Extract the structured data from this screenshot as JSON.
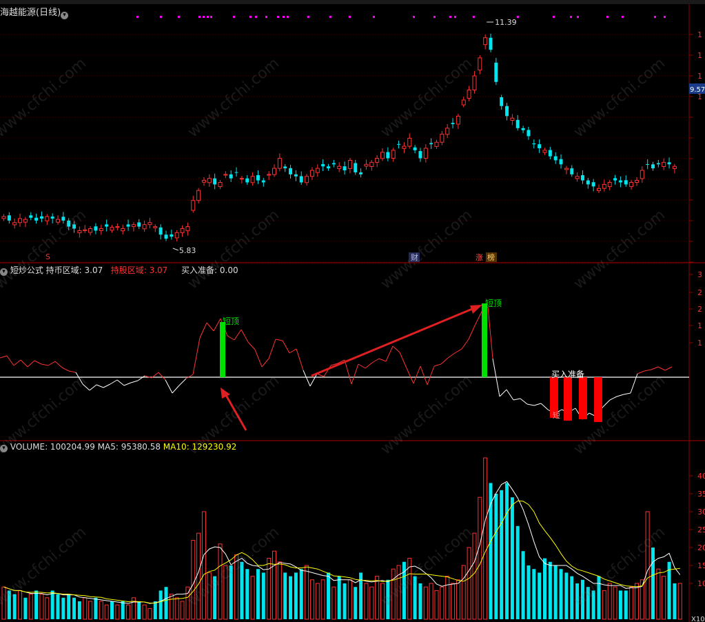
{
  "header": {
    "stock_title": "海越能源(日线)"
  },
  "price_panel": {
    "high_label": "11.39",
    "low_label": "5.83",
    "current_price_tag": "9.57",
    "marker_s": "S",
    "event_fin": "财",
    "event_zhang": "涨",
    "event_bang": "榜",
    "y_ticks": [
      "1",
      "1",
      "1",
      "1"
    ]
  },
  "indicator_panel": {
    "name": "短炒公式",
    "hold_label": "持币区域:",
    "hold_value": "3.07",
    "stock_label": "持股区域:",
    "stock_value": "3.07",
    "buy_label": "买入准备:",
    "buy_value": "0.00",
    "annot_top1": "短顶",
    "annot_top2": "短顶",
    "annot_buy": "买入准备",
    "annot_short": "短",
    "y_ticks": [
      "3",
      "2",
      "2",
      "1",
      "1"
    ]
  },
  "volume_panel": {
    "volume_label": "VOLUME: 100204.99",
    "ma5_label": "MA5: 95380.58",
    "ma10_label": "MA10: 129230.92",
    "y_ticks": [
      "40",
      "35",
      "30",
      "25",
      "20",
      "15",
      "10"
    ],
    "unit_label": "X10"
  },
  "watermark": "www.cfchi.com",
  "colors": {
    "up": "#ff3232",
    "down": "#00e5ee",
    "ma5": "#ffffff",
    "ma10": "#ffff00",
    "top_bar": "#00e000",
    "buy_bar": "#ff0000",
    "dots": "#ff00ff",
    "grid": "#8b0000"
  },
  "chart_data": [
    {
      "type": "candlestick",
      "title": "海越能源(日线)",
      "high": 11.39,
      "low": 5.83,
      "last": 9.57,
      "closes": [
        6.55,
        6.45,
        6.4,
        6.5,
        6.48,
        6.52,
        6.45,
        6.5,
        6.55,
        6.5,
        6.48,
        6.45,
        6.3,
        6.25,
        6.2,
        6.22,
        6.25,
        6.2,
        6.25,
        6.3,
        6.28,
        6.3,
        6.25,
        6.3,
        6.35,
        6.3,
        6.35,
        6.4,
        6.3,
        6.1,
        6.0,
        6.05,
        6.15,
        6.25,
        6.3,
        6.95,
        7.2,
        7.45,
        7.5,
        7.35,
        7.4,
        7.6,
        7.5,
        7.65,
        7.5,
        7.4,
        7.55,
        7.45,
        7.4,
        7.6,
        7.75,
        8.0,
        7.75,
        7.6,
        7.55,
        7.4,
        7.55,
        7.7,
        7.75,
        7.8,
        7.75,
        7.85,
        7.8,
        7.7,
        7.95,
        7.65,
        7.6,
        7.85,
        7.9,
        8.0,
        8.15,
        8.0,
        8.2,
        8.35,
        8.3,
        8.5,
        8.2,
        8.0,
        8.25,
        8.35,
        8.4,
        8.6,
        8.75,
        8.85,
        9.05,
        9.45,
        9.7,
        10.05,
        10.5,
        11.0,
        10.7,
        9.9,
        9.3,
        9.05,
        9.0,
        8.75,
        8.7,
        8.55,
        8.35,
        8.25,
        8.2,
        8.05,
        7.95,
        7.85,
        7.75,
        7.6,
        7.55,
        7.45,
        7.35,
        7.3,
        7.25,
        7.35,
        7.4,
        7.45,
        7.4,
        7.35,
        7.4,
        7.45,
        7.7,
        7.85,
        7.75,
        7.85,
        7.9,
        7.85,
        7.8
      ]
    },
    {
      "type": "line",
      "title": "短炒公式",
      "hold_zone": 3.07,
      "stock_zone": 3.07,
      "buy_ready": 0.0
    },
    {
      "type": "bar",
      "title": "VOLUME",
      "volume": 100204.99,
      "ma5": 95380.58,
      "ma10": 129230.92,
      "ylabel": "X10",
      "values": [
        9,
        8,
        7,
        8,
        6,
        7,
        8,
        7,
        6,
        8,
        7,
        6,
        7,
        6,
        5,
        6,
        5,
        6,
        5,
        4,
        5,
        4,
        5,
        4,
        6,
        5,
        4,
        3,
        5,
        8,
        9,
        7,
        6,
        5,
        9,
        22,
        24,
        30,
        13,
        12,
        21,
        15,
        15,
        18,
        16,
        14,
        12,
        14,
        13,
        17,
        19,
        16,
        13,
        12,
        13,
        14,
        15,
        11,
        10,
        11,
        13,
        9,
        12,
        10,
        11,
        9,
        13,
        10,
        9,
        12,
        10,
        11,
        14,
        15,
        16,
        17,
        12,
        10,
        9,
        10,
        8,
        9,
        12,
        10,
        11,
        15,
        20,
        24,
        34,
        45,
        38,
        35,
        36,
        38,
        34,
        26,
        19,
        15,
        14,
        13,
        17,
        16,
        15,
        14,
        13,
        12,
        10,
        11,
        9,
        8,
        12,
        8,
        10,
        9,
        8,
        8,
        9,
        10,
        11,
        30,
        20,
        14,
        12,
        16,
        10,
        10
      ]
    }
  ]
}
